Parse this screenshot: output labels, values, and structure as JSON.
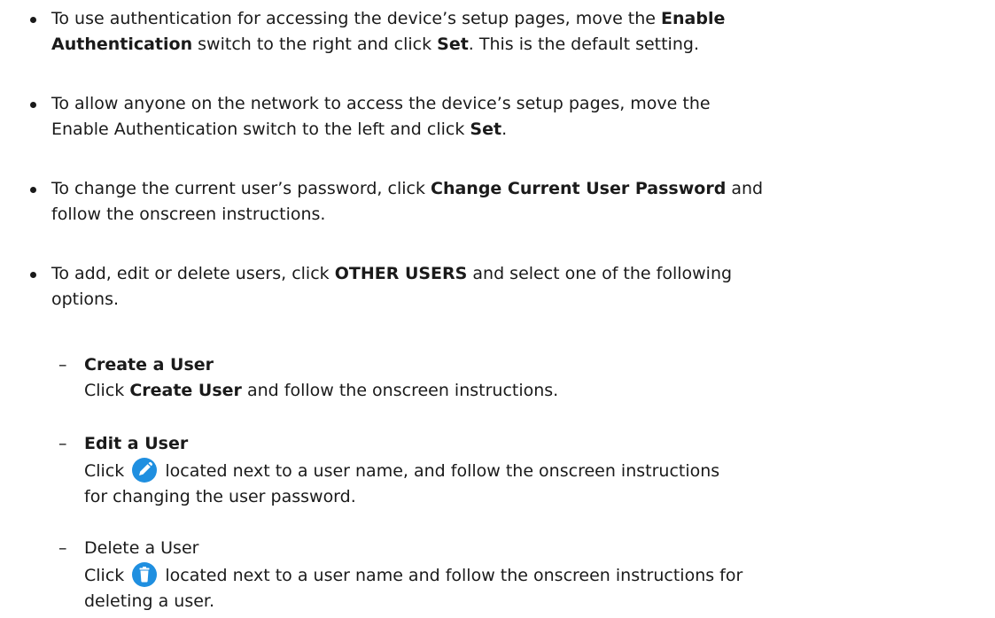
{
  "bullets": [
    {
      "t1": "To use authentication for accessing the device’s setup pages, move the ",
      "b1": "Enable",
      "b1b": "Authentication",
      "t2": " switch to the right and click ",
      "b2": "Set",
      "t3": ". This is the default setting."
    },
    {
      "t1": "To allow anyone on the network to access the device’s setup pages, move the",
      "t2": "Enable Authentication switch to the left and click ",
      "b1": "Set",
      "t3": "."
    },
    {
      "t1": "To change the current user’s password, click ",
      "b1": "Change Current User Password",
      "t2": " and",
      "t3": "follow the onscreen instructions."
    },
    {
      "t1": "To add, edit or delete users, click ",
      "b1": "OTHER USERS",
      "t2": " and select one of the following",
      "t3": "options."
    }
  ],
  "sub_items": [
    {
      "dash": "–",
      "heading": "Create a User",
      "l1a": "Click ",
      "l1b": "Create User",
      "l1c": " and follow the onscreen instructions."
    },
    {
      "dash": "–",
      "heading": "Edit a User",
      "l1a": "Click ",
      "l1c": " located next to a user name, and follow the onscreen instructions",
      "l2": "for changing the user password.",
      "icon": "pencil-icon"
    },
    {
      "dash": "–",
      "heading": "Delete a User",
      "l1a": "Click ",
      "l1c": " located next to a user name and follow the onscreen instructions for",
      "l2": "deleting a user.",
      "icon": "trash-icon"
    }
  ],
  "colors": {
    "icon_blue": "#1f8fe0",
    "text": "#1a1a1a"
  }
}
